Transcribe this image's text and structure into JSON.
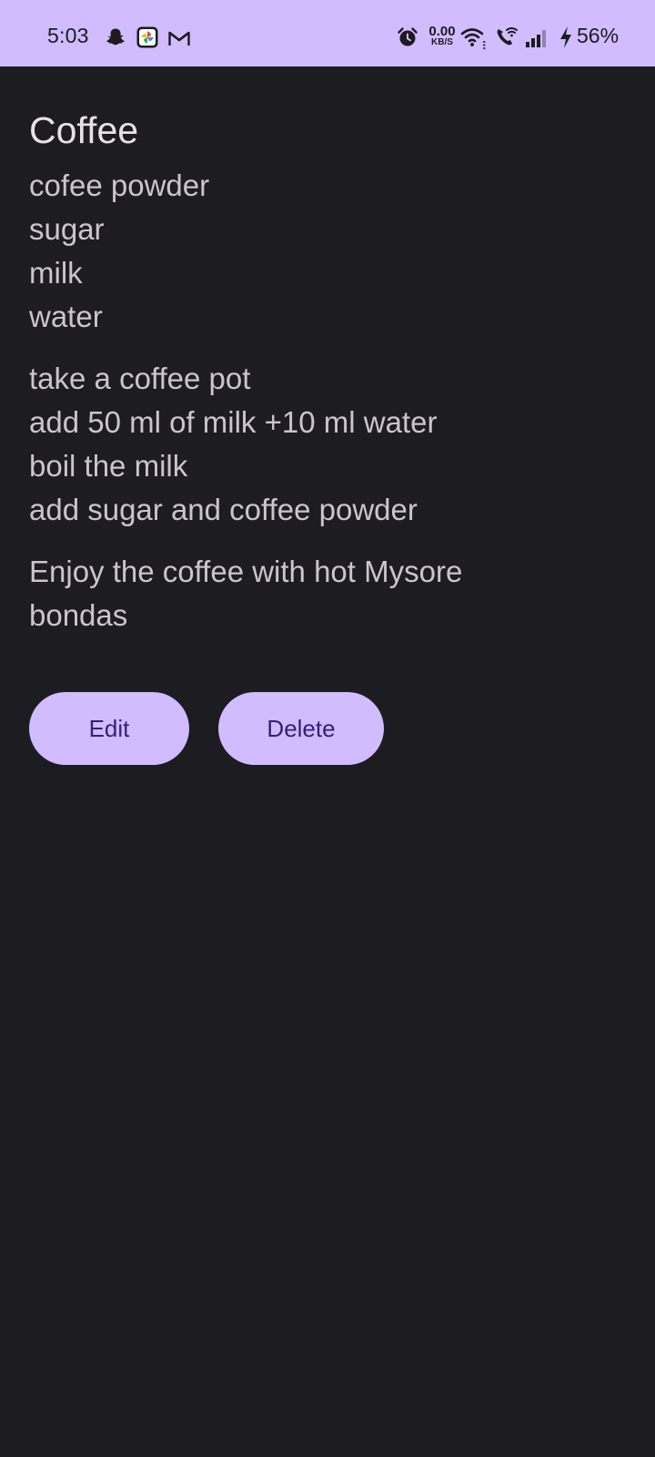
{
  "status_bar": {
    "time": "5:03",
    "notification_icons": [
      "snapchat-icon",
      "photos-icon",
      "gmail-icon"
    ],
    "system_icons": [
      "alarm-icon",
      "wifi-icon",
      "wifi-call-icon",
      "signal-icon",
      "charging-icon"
    ],
    "network_speed_value": "0.00",
    "network_speed_unit": "KB/S",
    "battery": "56%"
  },
  "recipe": {
    "title": "Coffee",
    "ingredients": [
      "cofee powder",
      "sugar",
      "milk",
      "water"
    ],
    "steps": [
      "take a coffee pot",
      "add 50 ml of milk +10 ml water",
      "boil the milk",
      "add sugar and coffee powder"
    ],
    "note": [
      "Enjoy the coffee with hot Mysore",
      "bondas"
    ]
  },
  "actions": {
    "edit_label": "Edit",
    "delete_label": "Delete"
  },
  "colors": {
    "accent": "#d0bcff",
    "on_accent": "#381e72",
    "background": "#1d1c21",
    "title_text": "#e6e1e5",
    "body_text": "#cac4d0"
  }
}
